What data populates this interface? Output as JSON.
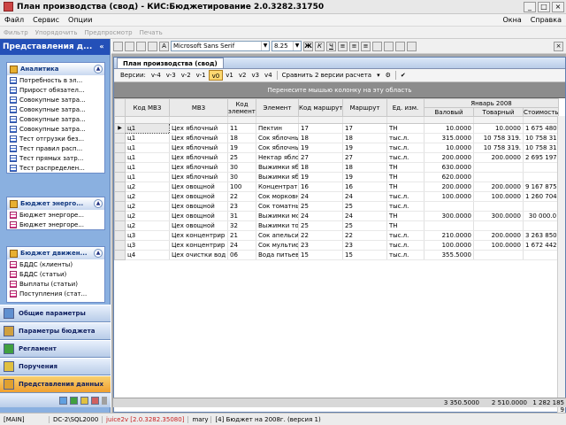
{
  "window": {
    "title": "План производства (свод) - КИС:Бюджетирование  2.0.3282.31750"
  },
  "menu": {
    "items": [
      "Файл",
      "Сервис",
      "Опции"
    ],
    "right": [
      "Окна",
      "Справка"
    ]
  },
  "toolbar1": {
    "items": [
      "Фильтр",
      "Упорядочить",
      "Предпросмотр",
      "Печать"
    ]
  },
  "sidebar": {
    "header": "Представления д...",
    "panels": [
      {
        "title": "Аналитика",
        "items": [
          "Потребность в эл...",
          "Прирост обязател...",
          "Совокупные затра...",
          "Совокупные затра...",
          "Совокупные затра...",
          "Совокупные затра...",
          "Тест отгрузки без...",
          "Тест правил расп...",
          "Тест прямых затр...",
          "Тест распределен..."
        ]
      },
      {
        "title": "Бюджет энерго...",
        "items": [
          "Бюджет энергоре...",
          "Бюджет энергоре..."
        ]
      },
      {
        "title": "Бюджет движен...",
        "items": [
          "БДДС (клиенты)",
          "БДДС (статьи)",
          "Выплаты (статьи)",
          "Поступления (стат..."
        ]
      }
    ],
    "nav": [
      "Общие параметры",
      "Параметры бюджета",
      "Регламент",
      "Поручения",
      "Представления данных"
    ]
  },
  "format": {
    "font": "Microsoft Sans Serif",
    "size": "8.25"
  },
  "doc": {
    "tab": "План производства (свод)",
    "versions_label": "Версии:",
    "versions": [
      "v-4",
      "v-3",
      "v-2",
      "v-1",
      "v0",
      "v1",
      "v2",
      "v3",
      "v4"
    ],
    "selected_version": "v0",
    "compare": "Сравнить 2 версии расчета",
    "group_hint": "Перенесите мышью колонку на эту область",
    "period": "Январь 2008",
    "columns": [
      "Код МВЗ",
      "МВЗ",
      "Код элемента",
      "Элемент",
      "Код маршрута",
      "Маршрут",
      "Ед. изм.",
      "Валовый",
      "Товарный",
      "Стоимость"
    ],
    "rows": [
      [
        "ц1",
        "Цех яблочный",
        "11",
        "Пектин",
        "17",
        "17",
        "ТН",
        "10.0000",
        "10.0000",
        "1 675 480."
      ],
      [
        "ц1",
        "Цех яблочный",
        "18",
        "Сок яблочный",
        "18",
        "18",
        "тыс.л.",
        "315.0000",
        "10 758 319.",
        "10 758 319."
      ],
      [
        "ц1",
        "Цех яблочный",
        "19",
        "Сок яблочный",
        "19",
        "19",
        "тыс.л.",
        "10.0000",
        "10 758 319.",
        "10 758 319."
      ],
      [
        "ц1",
        "Цех яблочный",
        "25",
        "Нектар яблочн",
        "27",
        "27",
        "тыс.л.",
        "200.0000",
        "200.0000",
        "2 695 197.4"
      ],
      [
        "ц1",
        "Цех яблочный",
        "30",
        "Выжимки ябло",
        "18",
        "18",
        "ТН",
        "630.0000",
        "",
        ""
      ],
      [
        "ц1",
        "Цех яблочный",
        "30",
        "Выжимки ябло",
        "19",
        "19",
        "ТН",
        "620.0000",
        "",
        ""
      ],
      [
        "ц2",
        "Цех овощной",
        "100",
        "Концентрат том",
        "16",
        "16",
        "ТН",
        "200.0000",
        "200.0000",
        "9 167 875.9"
      ],
      [
        "ц2",
        "Цех овощной",
        "22",
        "Сок морковный",
        "24",
        "24",
        "тыс.л.",
        "100.0000",
        "100.0000",
        "1 260 704."
      ],
      [
        "ц2",
        "Цех овощной",
        "23",
        "Сок томатный",
        "25",
        "25",
        "тыс.л.",
        "",
        "",
        ""
      ],
      [
        "ц2",
        "Цех овощной",
        "31",
        "Выжимки морк",
        "24",
        "24",
        "ТН",
        "300.0000",
        "300.0000",
        "30 000.0"
      ],
      [
        "ц2",
        "Цех овощной",
        "32",
        "Выжимки томат",
        "25",
        "25",
        "ТН",
        "",
        "",
        ""
      ],
      [
        "ц3",
        "Цех концентрир",
        "21",
        "Сок апельсинов",
        "22",
        "22",
        "тыс.л.",
        "210.0000",
        "200.0000",
        "3 263 850.9"
      ],
      [
        "ц3",
        "Цех концентрир",
        "24",
        "Сок мультифру",
        "23",
        "23",
        "тыс.л.",
        "100.0000",
        "100.0000",
        "1 672 442.6"
      ],
      [
        "ц4",
        "Цех очистки вод",
        "06",
        "Вода питьевая",
        "15",
        "15",
        "тыс.л.",
        "355.5000",
        "",
        ""
      ]
    ],
    "totals": [
      "3 350.5000",
      "2 510.0000",
      "1 282 185 9"
    ]
  },
  "statusbar": {
    "mode": "[MAIN]",
    "server": "DC-2\\SQL2000",
    "version": "juice2v [2.0.3282.35080]",
    "user": "mary",
    "budget": "[4] Бюджет на 2008г. (версия 1)"
  }
}
